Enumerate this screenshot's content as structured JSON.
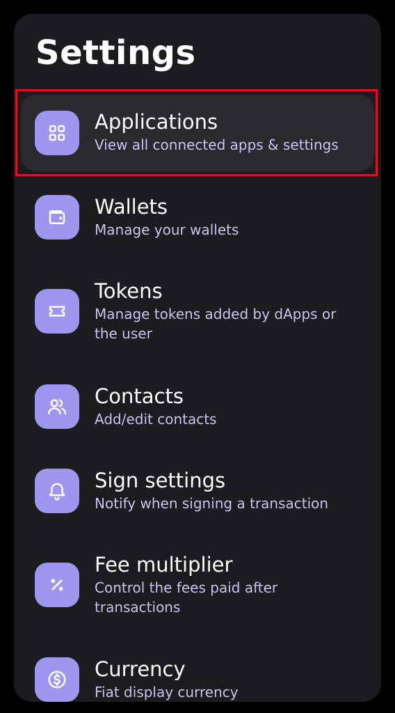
{
  "header": {
    "title": "Settings"
  },
  "items": [
    {
      "title": "Applications",
      "subtitle": "View all connected apps & settings",
      "icon": "grid-icon"
    },
    {
      "title": "Wallets",
      "subtitle": "Manage your wallets",
      "icon": "wallet-icon"
    },
    {
      "title": "Tokens",
      "subtitle": "Manage tokens added by dApps or the user",
      "icon": "ticket-icon"
    },
    {
      "title": "Contacts",
      "subtitle": "Add/edit contacts",
      "icon": "users-icon"
    },
    {
      "title": "Sign settings",
      "subtitle": "Notify when signing a transaction",
      "icon": "bell-icon"
    },
    {
      "title": "Fee multiplier",
      "subtitle": "Control the fees paid after transactions",
      "icon": "percent-icon"
    },
    {
      "title": "Currency",
      "subtitle": "Fiat display currency",
      "icon": "dollar-coin-icon"
    }
  ],
  "colors": {
    "background": "#000000",
    "panel": "#1c1b1f",
    "active_row": "#2a2930",
    "icon_tile": "#9e95ee",
    "subtitle": "#c9c5ec",
    "highlight": "#e0101e"
  }
}
